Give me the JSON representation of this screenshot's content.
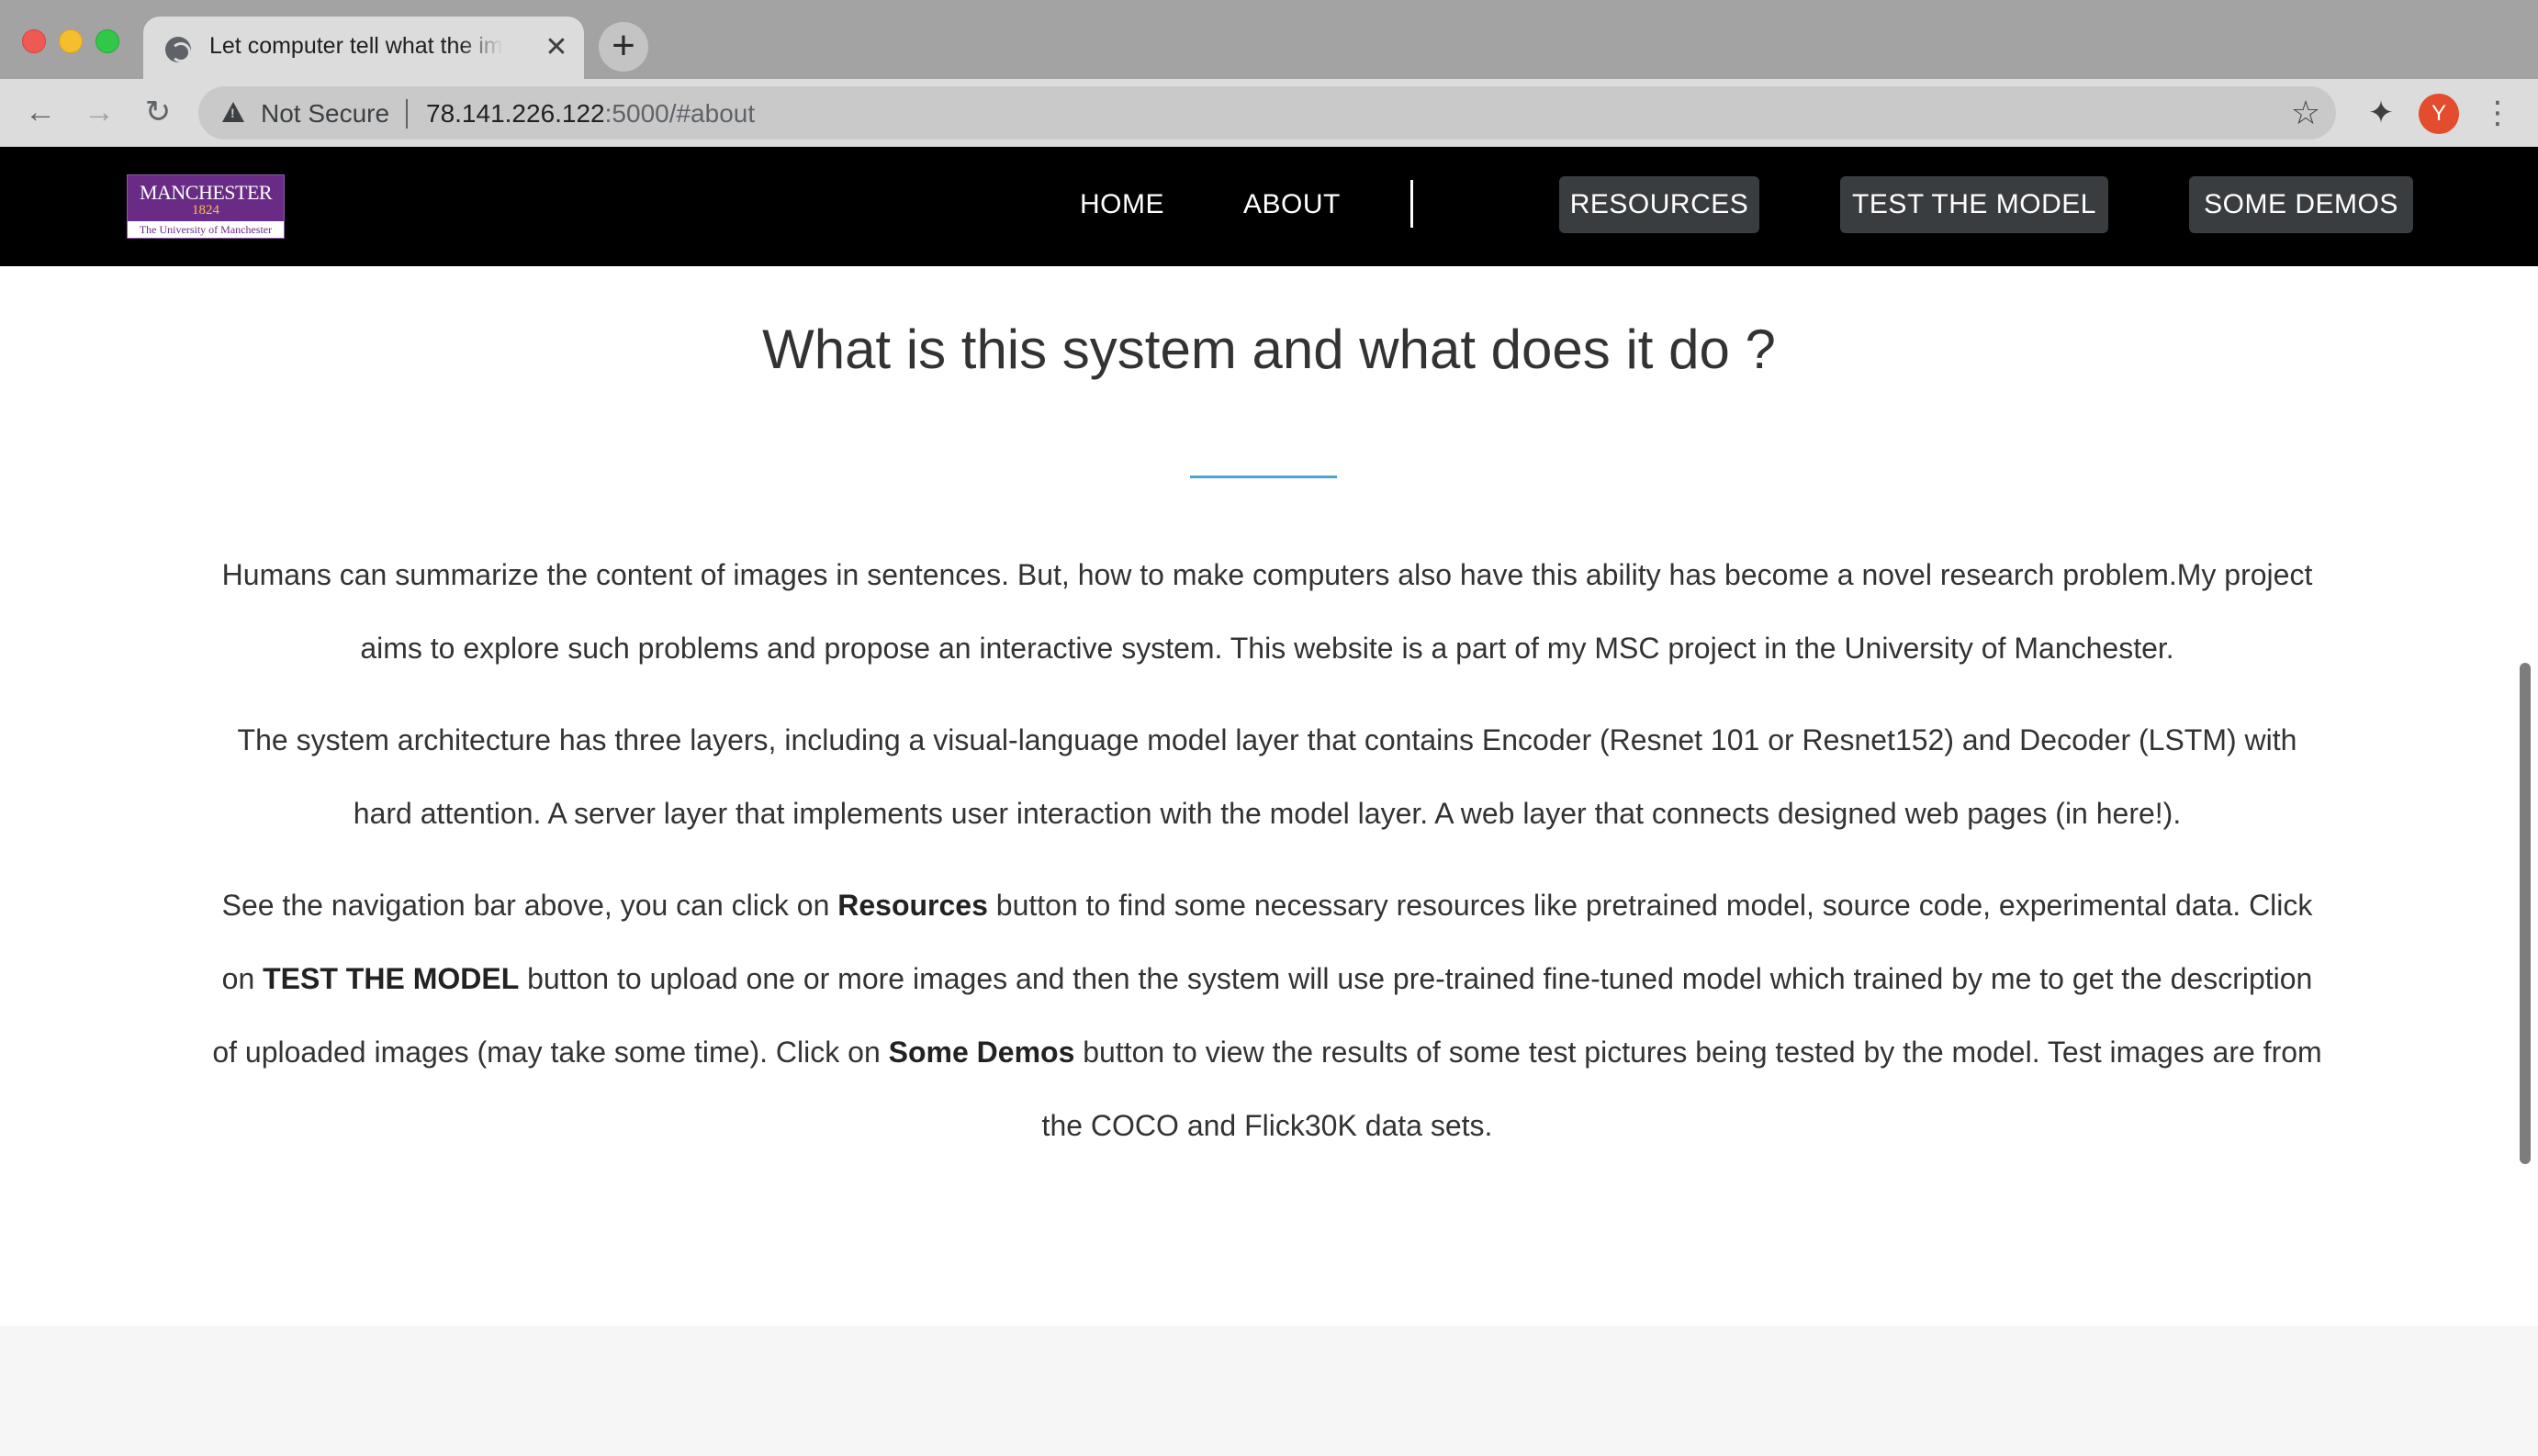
{
  "browser": {
    "tab_title": "Let computer tell what the image",
    "tab_close": "✕",
    "new_tab": "+",
    "security_label": "Not Secure",
    "url_host": "78.141.226.122",
    "url_rest": ":5000/#about",
    "profile_initial": "Y",
    "icons": {
      "back": "←",
      "forward": "→",
      "reload": "↻",
      "star": "☆",
      "extensions": "✦",
      "menu": "⋮"
    }
  },
  "site": {
    "logo": {
      "name": "MANCHESTER",
      "year": "1824",
      "subtitle": "The University of Manchester"
    },
    "nav": {
      "home": "HOME",
      "about": "ABOUT",
      "resources": "RESOURCES",
      "test_model": "TEST THE MODEL",
      "demos": "SOME DEMOS"
    }
  },
  "about": {
    "title": "What is this system and what does it do ?",
    "paragraph1": "Humans can summarize the content of images in sentences. But, how to make computers also have this ability has become a novel research problem.My project aims to explore such problems and propose an interactive system. This website is a part of my MSC project in the University of Manchester.",
    "paragraph2": "The system architecture has three layers, including a visual-language model layer that contains Encoder (Resnet 101 or Resnet152) and Decoder (LSTM) with hard attention. A server layer that implements user interaction with the model layer. A web layer that connects designed web pages (in here!).",
    "paragraph3": {
      "part1": "See the navigation bar above, you can click on ",
      "bold1": "Resources",
      "part2": " button to find some necessary resources like pretrained model, source code, experimental data. Click on ",
      "bold2": "TEST THE MODEL",
      "part3": " button to upload one or more images and then the system will use pre-trained fine-tuned model which trained by me to get the description of uploaded images (may take some time). Click on ",
      "bold3": "Some Demos",
      "part4": " button to view the results of some test pictures being tested by the model. Test images are from the COCO and Flick30K data sets."
    }
  },
  "colors": {
    "navbar_bg": "#000000",
    "nav_button_bg": "#3a3d40",
    "accent_underline": "#4aa6cf",
    "logo_purple": "#6a2b86",
    "profile_avatar": "#e34c2c"
  }
}
